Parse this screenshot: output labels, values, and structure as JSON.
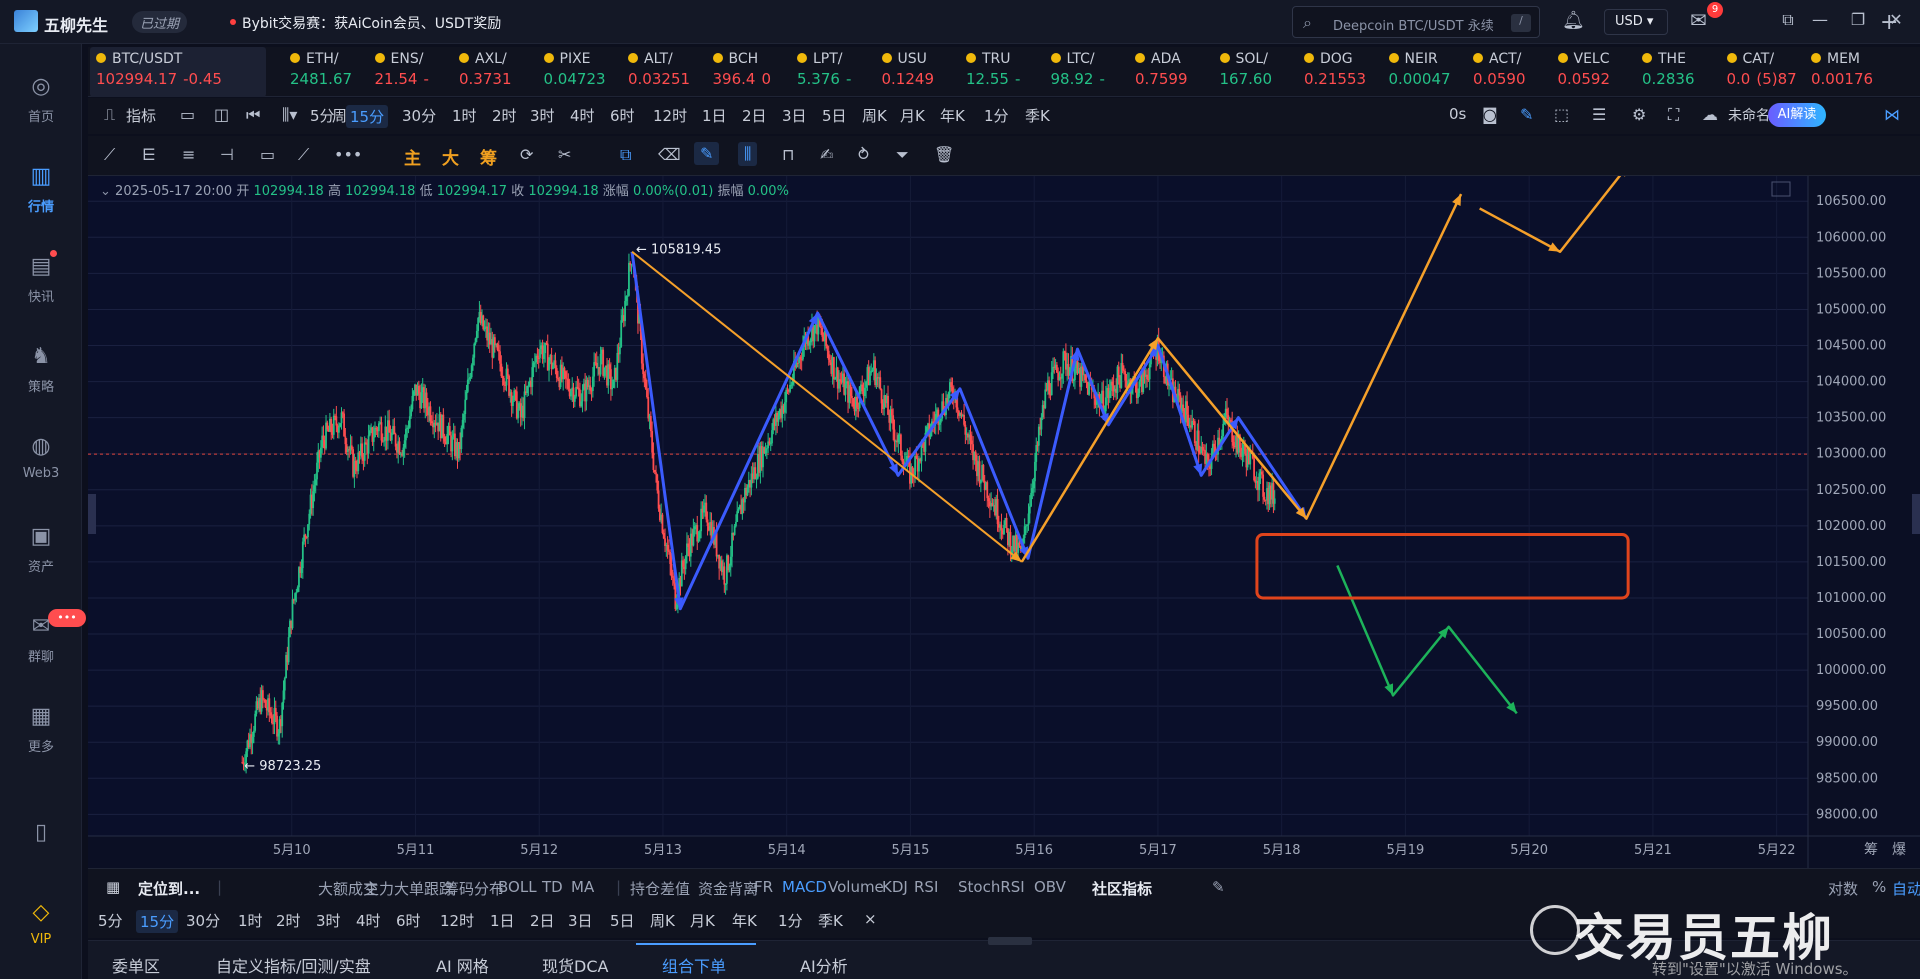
{
  "titlebar": {
    "app_name": "五柳先生",
    "status_badge": "已过期",
    "promo": "Bybit交易赛：获AiCoin会员、USDT奖励",
    "search_placeholder": "Deepcoin BTC/USDT 永续",
    "search_shortcut": "/",
    "currency": "USD ▾",
    "mail_count": "9"
  },
  "sidebar": [
    {
      "icon": "home-icon",
      "glyph": "◎",
      "label": "首页"
    },
    {
      "icon": "market-icon",
      "glyph": "▥",
      "label": "行情",
      "active": true
    },
    {
      "icon": "news-icon",
      "glyph": "▤",
      "label": "快讯"
    },
    {
      "icon": "strategy-icon",
      "glyph": "♞",
      "label": "策略"
    },
    {
      "icon": "web3-icon",
      "glyph": "◍",
      "label": "Web3"
    },
    {
      "icon": "wallet-icon",
      "glyph": "▣",
      "label": "资产"
    },
    {
      "icon": "chat-icon",
      "glyph": "✉",
      "label": "群聊"
    },
    {
      "icon": "more-icon",
      "glyph": "▦",
      "label": "更多"
    },
    {
      "icon": "phone-icon",
      "glyph": "▯",
      "label": ""
    },
    {
      "icon": "vip-icon",
      "glyph": "◇",
      "label": "VIP"
    }
  ],
  "chat_badge": "•••",
  "ticker": [
    {
      "symbol": "BTC/USDT",
      "price": "102994.17",
      "change": "-0.45",
      "dir": "dn"
    },
    {
      "symbol": "ETH/",
      "price": "2481.67",
      "change": "",
      "dir": "up"
    },
    {
      "symbol": "ENS/",
      "price": "21.54",
      "change": "-",
      "dir": "dn"
    },
    {
      "symbol": "AXL/",
      "price": "0.3731",
      "change": "",
      "dir": "dn"
    },
    {
      "symbol": "PIXE",
      "price": "0.04723",
      "change": "",
      "dir": "up"
    },
    {
      "symbol": "ALT/",
      "price": "0.03251",
      "change": "",
      "dir": "dn"
    },
    {
      "symbol": "BCH",
      "price": "396.4",
      "change": "0",
      "dir": "dn"
    },
    {
      "symbol": "LPT/",
      "price": "5.376",
      "change": "-",
      "dir": "up"
    },
    {
      "symbol": "USU",
      "price": "0.1249",
      "change": "",
      "dir": "dn"
    },
    {
      "symbol": "TRU",
      "price": "12.55",
      "change": "-",
      "dir": "up"
    },
    {
      "symbol": "LTC/",
      "price": "98.92",
      "change": "-",
      "dir": "up"
    },
    {
      "symbol": "ADA",
      "price": "0.7599",
      "change": "",
      "dir": "dn"
    },
    {
      "symbol": "SOL/",
      "price": "167.60",
      "change": "",
      "dir": "up"
    },
    {
      "symbol": "DOG",
      "price": "0.21553",
      "change": "",
      "dir": "dn"
    },
    {
      "symbol": "NEIR",
      "price": "0.00047",
      "change": "",
      "dir": "up"
    },
    {
      "symbol": "ACT/",
      "price": "0.0590",
      "change": "",
      "dir": "dn"
    },
    {
      "symbol": "VELC",
      "price": "0.0592",
      "change": "",
      "dir": "dn"
    },
    {
      "symbol": "THE",
      "price": "0.2836",
      "change": "",
      "dir": "up"
    },
    {
      "symbol": "CAT/",
      "price": "0.0",
      "change": "(5)87",
      "dir": "dn"
    },
    {
      "symbol": "MEM",
      "price": "0.00176",
      "change": "",
      "dir": "dn"
    }
  ],
  "toolbar1": {
    "indicator_label": "指标",
    "period_label": "周期",
    "periods": [
      "5分",
      "15分",
      "30分",
      "1时",
      "2时",
      "3时",
      "4时",
      "6时",
      "12时",
      "1日",
      "2日",
      "3日",
      "5日",
      "周K",
      "月K",
      "年K",
      "1分",
      "季K"
    ],
    "active_period": "15分",
    "countdown": "0s",
    "layout_name": "未命名",
    "ai_button": "AI解读"
  },
  "toolbar2": {
    "main": "主",
    "big": "大",
    "chips": "筹"
  },
  "ohlc": {
    "date": "2025-05-17 20:00",
    "open_label": "开",
    "open": "102994.18",
    "high_label": "高",
    "high": "102994.18",
    "low_label": "低",
    "low": "102994.17",
    "close_label": "收",
    "close": "102994.18",
    "change_label": "涨幅",
    "change": "0.00%(0.01)",
    "amp_label": "振幅",
    "amp": "0.00%"
  },
  "chart_data": {
    "type": "candlestick",
    "symbol": "BTC/USDT",
    "interval": "15分",
    "x_ticks": [
      "5月10",
      "5月11",
      "5月12",
      "5月13",
      "5月14",
      "5月15",
      "5月16",
      "5月17",
      "5月18",
      "5月19",
      "5月20",
      "5月21",
      "5月22"
    ],
    "y_ticks": [
      106500,
      106000,
      105500,
      105000,
      104500,
      104000,
      103500,
      103000,
      102500,
      102000,
      101500,
      101000,
      100500,
      100000,
      99500,
      99000,
      98500,
      98000
    ],
    "ylim": [
      97700,
      106850
    ],
    "current_price": 102994.17,
    "annotations": {
      "high_label": "105819.45",
      "high_day": 12.75,
      "low_label": "98723.25",
      "low_day": 9.6
    },
    "price_path": [
      [
        9.6,
        98723
      ],
      [
        9.75,
        99600
      ],
      [
        9.9,
        99200
      ],
      [
        10.0,
        100800
      ],
      [
        10.1,
        101800
      ],
      [
        10.25,
        103200
      ],
      [
        10.4,
        103500
      ],
      [
        10.5,
        102800
      ],
      [
        10.7,
        103400
      ],
      [
        10.9,
        103100
      ],
      [
        11.0,
        103900
      ],
      [
        11.2,
        103400
      ],
      [
        11.35,
        103000
      ],
      [
        11.5,
        104900
      ],
      [
        11.7,
        104200
      ],
      [
        11.85,
        103500
      ],
      [
        12.0,
        104500
      ],
      [
        12.2,
        104000
      ],
      [
        12.35,
        103800
      ],
      [
        12.5,
        104300
      ],
      [
        12.6,
        103900
      ],
      [
        12.75,
        105819
      ],
      [
        12.85,
        104000
      ],
      [
        12.95,
        102500
      ],
      [
        13.1,
        101000
      ],
      [
        13.2,
        101700
      ],
      [
        13.35,
        102200
      ],
      [
        13.5,
        101300
      ],
      [
        13.65,
        102400
      ],
      [
        13.8,
        103000
      ],
      [
        14.0,
        103800
      ],
      [
        14.15,
        104600
      ],
      [
        14.25,
        104800
      ],
      [
        14.4,
        104100
      ],
      [
        14.55,
        103700
      ],
      [
        14.7,
        104200
      ],
      [
        14.85,
        103400
      ],
      [
        15.0,
        102700
      ],
      [
        15.2,
        103500
      ],
      [
        15.35,
        103900
      ],
      [
        15.5,
        103000
      ],
      [
        15.65,
        102400
      ],
      [
        15.8,
        101800
      ],
      [
        15.9,
        101600
      ],
      [
        16.0,
        102800
      ],
      [
        16.1,
        103900
      ],
      [
        16.25,
        104300
      ],
      [
        16.4,
        104000
      ],
      [
        16.55,
        103700
      ],
      [
        16.7,
        104100
      ],
      [
        16.85,
        103900
      ],
      [
        17.0,
        104500
      ],
      [
        17.1,
        103900
      ],
      [
        17.25,
        103500
      ],
      [
        17.4,
        102800
      ],
      [
        17.55,
        103500
      ],
      [
        17.65,
        103100
      ],
      [
        17.75,
        102900
      ],
      [
        17.85,
        102500
      ],
      [
        17.95,
        102400
      ]
    ],
    "drawings": {
      "orange_pattern": [
        [
          12.75,
          105800
        ],
        [
          15.9,
          101500
        ],
        [
          17.0,
          104600
        ],
        [
          18.2,
          102100
        ],
        [
          19.45,
          106600
        ],
        [
          19.6,
          106400
        ],
        [
          20.25,
          105800
        ],
        [
          20.8,
          107000
        ]
      ],
      "orange_wedge_upper": [
        [
          12.75,
          105800
        ],
        [
          15.9,
          101500
        ]
      ],
      "green_path": [
        [
          18.45,
          101450
        ],
        [
          18.9,
          99650
        ],
        [
          19.35,
          100600
        ],
        [
          19.9,
          99400
        ]
      ],
      "blue_swings": [
        [
          12.75,
          105800
        ],
        [
          13.14,
          100850
        ],
        [
          14.25,
          104950
        ],
        [
          14.9,
          102700
        ],
        [
          15.4,
          103900
        ],
        [
          15.95,
          101550
        ],
        [
          16.35,
          104450
        ],
        [
          16.6,
          103400
        ],
        [
          17.0,
          104500
        ],
        [
          17.35,
          102700
        ],
        [
          17.65,
          103500
        ],
        [
          18.2,
          102100
        ]
      ],
      "box": {
        "x_start": 17.8,
        "x_end": 20.8,
        "y_top": 101880,
        "y_bottom": 101000,
        "color": "#e0441c"
      }
    },
    "colors": {
      "up": "#24c187",
      "down": "#ff4d4f",
      "bg": "#0a0f2a",
      "orange": "#f5a02a",
      "blue": "#3b5bfd",
      "green": "#1db35a",
      "current_line": "#e0443c"
    },
    "corner_labels": [
      "筹",
      "爆"
    ]
  },
  "indicators": {
    "locate": "定位到...",
    "items": [
      "大额成交",
      "主力大单跟踪",
      "筹码分布",
      "BOLL",
      "TD",
      "MA",
      "持仓差值",
      "资金背离",
      "FR",
      "MACD",
      "Volume",
      "KDJ",
      "RSI",
      "StochRSI",
      "OBV",
      "社区指标"
    ],
    "active": "MACD",
    "right": [
      "对数",
      "%",
      "自动"
    ]
  },
  "bottom_periods": [
    "5分",
    "15分",
    "30分",
    "1时",
    "2时",
    "3时",
    "4时",
    "6时",
    "12时",
    "1日",
    "2日",
    "3日",
    "5日",
    "周K",
    "月K",
    "年K",
    "1分",
    "季K",
    "×"
  ],
  "bottom_tabs": [
    "委单区",
    "自定义指标/回测/实盘",
    "AI 网格",
    "现货DCA",
    "组合下单",
    "AI分析"
  ],
  "active_tab": "组合下单",
  "watermark": "交易员五柳",
  "activate_windows": "转到\"设置\"以激活 Windows。"
}
